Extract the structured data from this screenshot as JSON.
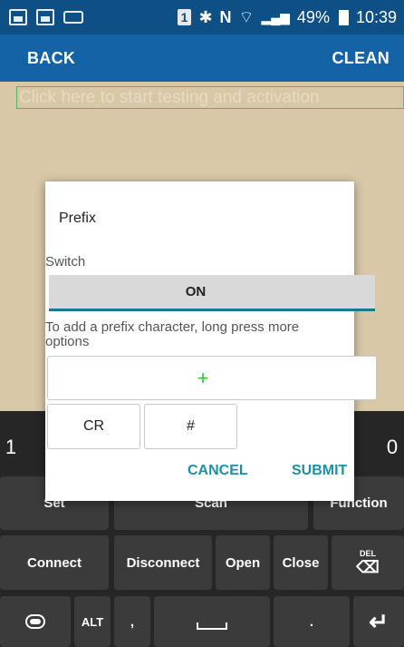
{
  "status_bar": {
    "badge": "1",
    "bluetooth_icon": "bluetooth-icon",
    "nfc_icon": "nfc-icon",
    "wifi_icon": "wifi-icon",
    "signal_icon": "signal-icon",
    "battery": "49%",
    "time": "10:39"
  },
  "app_bar": {
    "back": "BACK",
    "clean": "CLEAN"
  },
  "test_field": {
    "placeholder": "Click here to start testing and activation"
  },
  "keyboard": {
    "row_numbers": [
      "1",
      "0"
    ],
    "row1": [
      "Set",
      "Scan",
      "Function"
    ],
    "row2": [
      "Connect",
      "Disconnect",
      "Open",
      "Close",
      "DEL"
    ],
    "row3": [
      "ALT",
      ",",
      "."
    ]
  },
  "dialog": {
    "title": "Prefix",
    "switch_label": "Switch",
    "toggle_state": "ON",
    "hint": "To add a prefix character, long press more options",
    "add_symbol": "+",
    "chips": [
      "CR",
      "#"
    ],
    "cancel": "CANCEL",
    "submit": "SUBMIT"
  }
}
